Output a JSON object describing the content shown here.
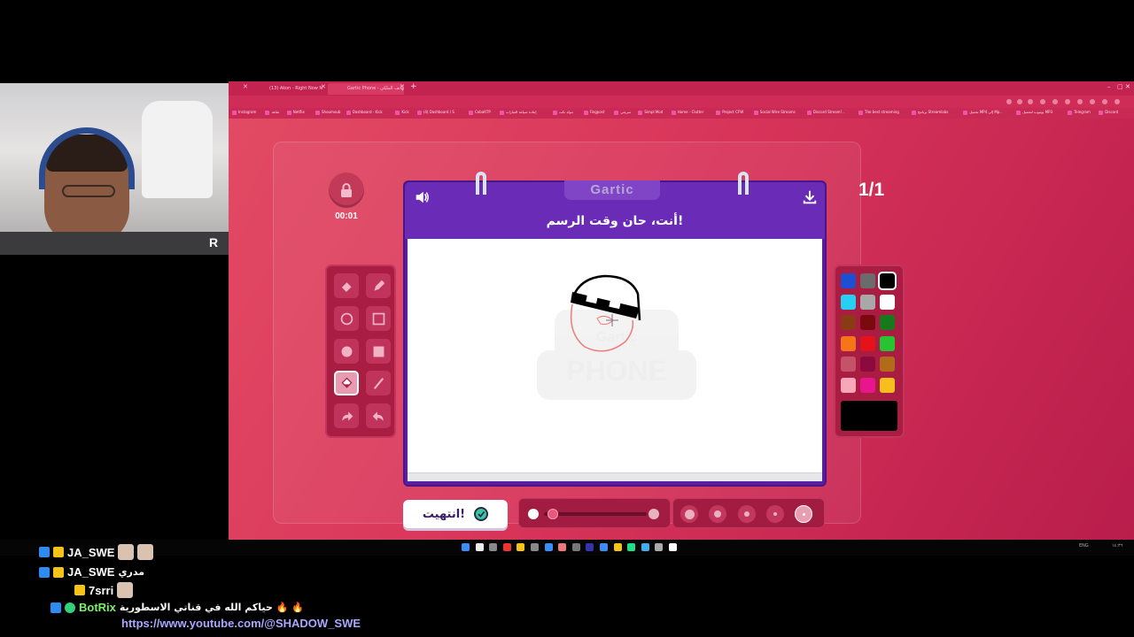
{
  "browser": {
    "tabs": [
      {
        "label": "(13) Akon - Right Now Na Na Na",
        "active": false
      },
      {
        "label": "Gartic Phone - لعبة الهاتف الملكي",
        "active": true
      }
    ],
    "bookmarks": [
      "Instagram",
      "شاهد",
      "Netflix",
      "Shoumoub",
      "Dashboard - Kick",
      "Kick",
      "(4) Dashboard / S",
      "CobaltTP",
      "إعادة صياغة العبارات",
      "مولد نكت",
      "Fingpost",
      "سريعي",
      "Simpl Mod",
      "Home - Clutter",
      "Project CFW",
      "Social Wire Streams",
      "Discord Stream!..",
      "The best streaming",
      "برنامج Streamlabs",
      "تحميل MP4 إلى Mp..",
      "يوتيوب لتحميل MP3",
      "Telegram",
      "Discord"
    ]
  },
  "game": {
    "logo": "Gartic",
    "prompt": "أنت، حان وقت الرسم!",
    "timer": "00:01",
    "round": "1/1",
    "done_label": "انتهيت!",
    "canvas_watermark_top": "Gartic",
    "canvas_watermark_bottom": "PHONE",
    "tools": [
      {
        "name": "eraser-icon",
        "selected": false
      },
      {
        "name": "pencil-icon",
        "selected": false
      },
      {
        "name": "circle-outline-icon",
        "selected": false
      },
      {
        "name": "square-outline-icon",
        "selected": false
      },
      {
        "name": "circle-filled-icon",
        "selected": false
      },
      {
        "name": "square-filled-icon",
        "selected": false
      },
      {
        "name": "fill-bucket-icon",
        "selected": true
      },
      {
        "name": "line-icon",
        "selected": false
      },
      {
        "name": "redo-icon",
        "selected": false
      },
      {
        "name": "undo-icon",
        "selected": false
      }
    ],
    "colors": [
      "#1d4fd0",
      "#6b6b6b",
      "#000000",
      "#27d0f3",
      "#a8a8a8",
      "#ffffff",
      "#8a3a14",
      "#7a0a10",
      "#167a1c",
      "#f57518",
      "#e51319",
      "#27c431",
      "#c4536a",
      "#8c0a3e",
      "#b06c1a",
      "#f7a7b6",
      "#e9158d",
      "#f7bf1d"
    ],
    "selected_color": "#000000",
    "opacity_level": 0.0,
    "brush_sizes": [
      1,
      2,
      3,
      4,
      5
    ],
    "selected_brush_size": 5
  },
  "taskbar": {
    "lang": "ENG",
    "clock": "١٤:٣٦"
  },
  "chat": {
    "messages": [
      {
        "user": "JA_SWE",
        "text": "",
        "user_color": "#ffffff"
      },
      {
        "user": "JA_SWE",
        "text": "مدري",
        "user_color": "#ffffff"
      },
      {
        "user": "7srri",
        "text": "",
        "user_color": "#ffffff"
      },
      {
        "user": "BotRix",
        "text": "حياكم الله في قناتي الاسطورية 🔥 🔥",
        "user_color": "#7cf06a"
      }
    ],
    "link": "https://www.youtube.com/@SHADOW_SWE"
  }
}
